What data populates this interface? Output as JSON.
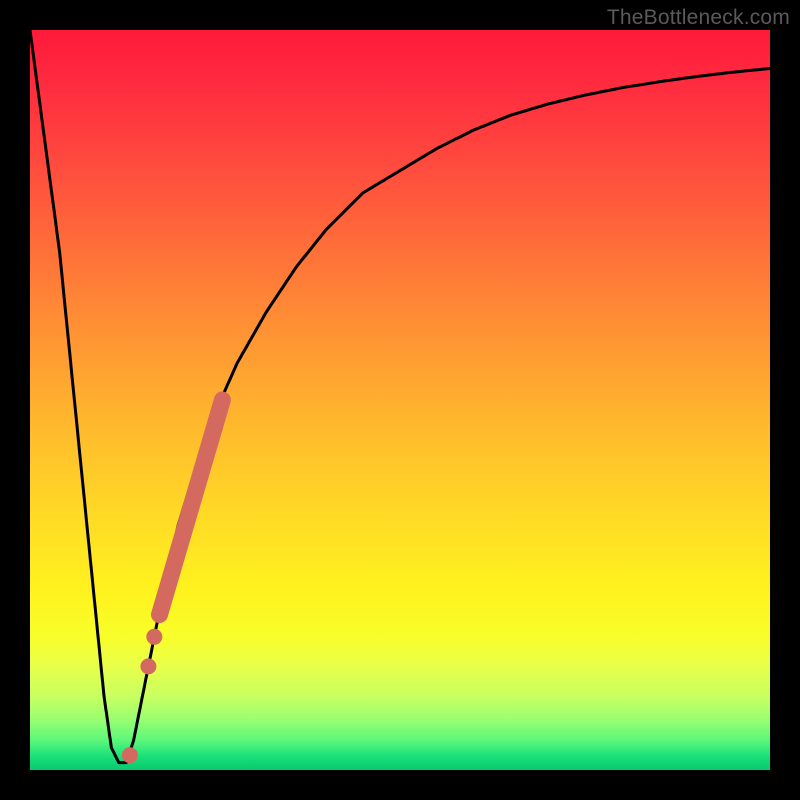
{
  "watermark": "TheBottleneck.com",
  "colors": {
    "curve": "#000000",
    "marker": "#d46a5f",
    "frame": "#000000"
  },
  "chart_data": {
    "type": "line",
    "title": "",
    "xlabel": "",
    "ylabel": "",
    "xlim": [
      0,
      100
    ],
    "ylim": [
      0,
      100
    ],
    "grid": false,
    "legend": false,
    "series": [
      {
        "name": "bottleneck-curve",
        "x": [
          0,
          4,
          8,
          10,
          11,
          12,
          13,
          14,
          16,
          18,
          20,
          24,
          28,
          32,
          36,
          40,
          45,
          50,
          55,
          60,
          65,
          70,
          75,
          80,
          85,
          90,
          95,
          100
        ],
        "y": [
          100,
          70,
          30,
          10,
          3,
          1,
          1,
          4,
          14,
          24,
          33,
          46,
          55,
          62,
          68,
          73,
          78,
          81,
          84,
          86.5,
          88.5,
          90,
          91.2,
          92.2,
          93,
          93.7,
          94.3,
          94.8
        ]
      }
    ],
    "markers": [
      {
        "name": "highlight-segment",
        "shape": "thick-line",
        "x": [
          17.5,
          26.0
        ],
        "y": [
          21,
          50
        ]
      },
      {
        "name": "dot-1",
        "shape": "circle",
        "x": 16.0,
        "y": 14
      },
      {
        "name": "dot-2",
        "shape": "circle",
        "x": 16.8,
        "y": 18
      },
      {
        "name": "dot-3",
        "shape": "circle",
        "x": 13.5,
        "y": 2
      }
    ]
  }
}
